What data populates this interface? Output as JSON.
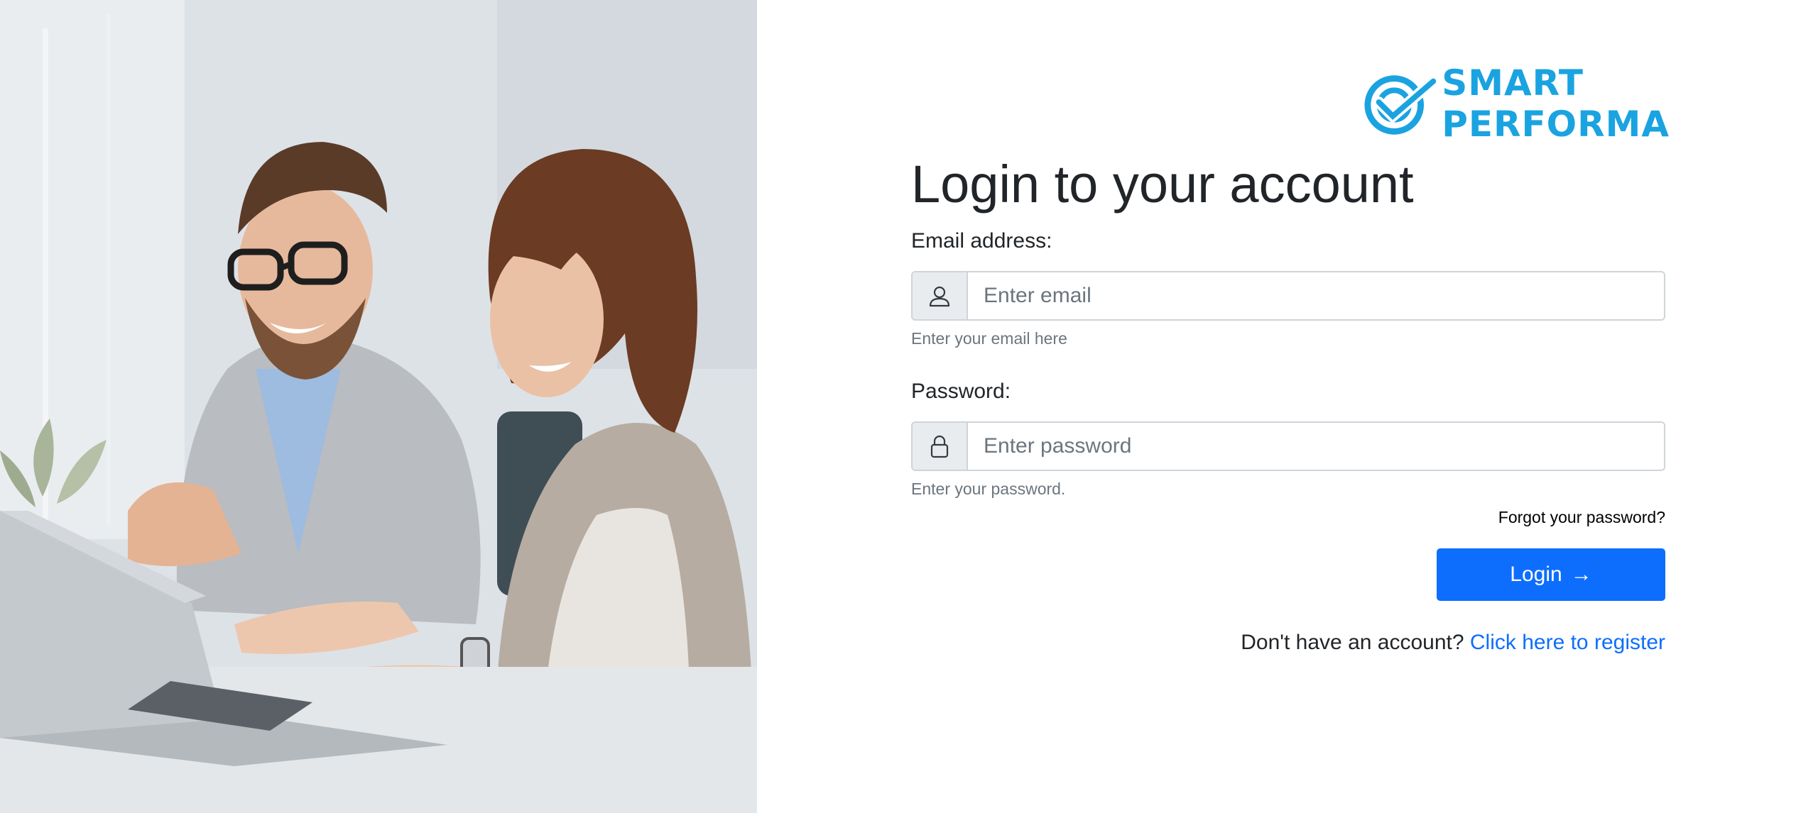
{
  "brand": {
    "name": "SMART PERFORMA",
    "color": "#1aa3e0",
    "logo_icon": "target-check-icon"
  },
  "hero": {
    "image": "two-people-smiling-at-laptops-photo"
  },
  "form": {
    "title": "Login to your account",
    "email": {
      "label": "Email address:",
      "placeholder": "Enter email",
      "value": "",
      "help": "Enter your email here",
      "icon": "user-icon"
    },
    "password": {
      "label": "Password:",
      "placeholder": "Enter password",
      "value": "",
      "help": "Enter your password.",
      "icon": "lock-icon"
    },
    "forgot_link": "Forgot your password?",
    "login_button": "Login",
    "login_arrow": "→",
    "register_prompt": "Don't have an account?",
    "register_link": "Click here to register"
  },
  "colors": {
    "primary": "#0d6efd",
    "muted": "#6c757d",
    "border": "#ced4da",
    "addon_bg": "#e9ecef"
  }
}
